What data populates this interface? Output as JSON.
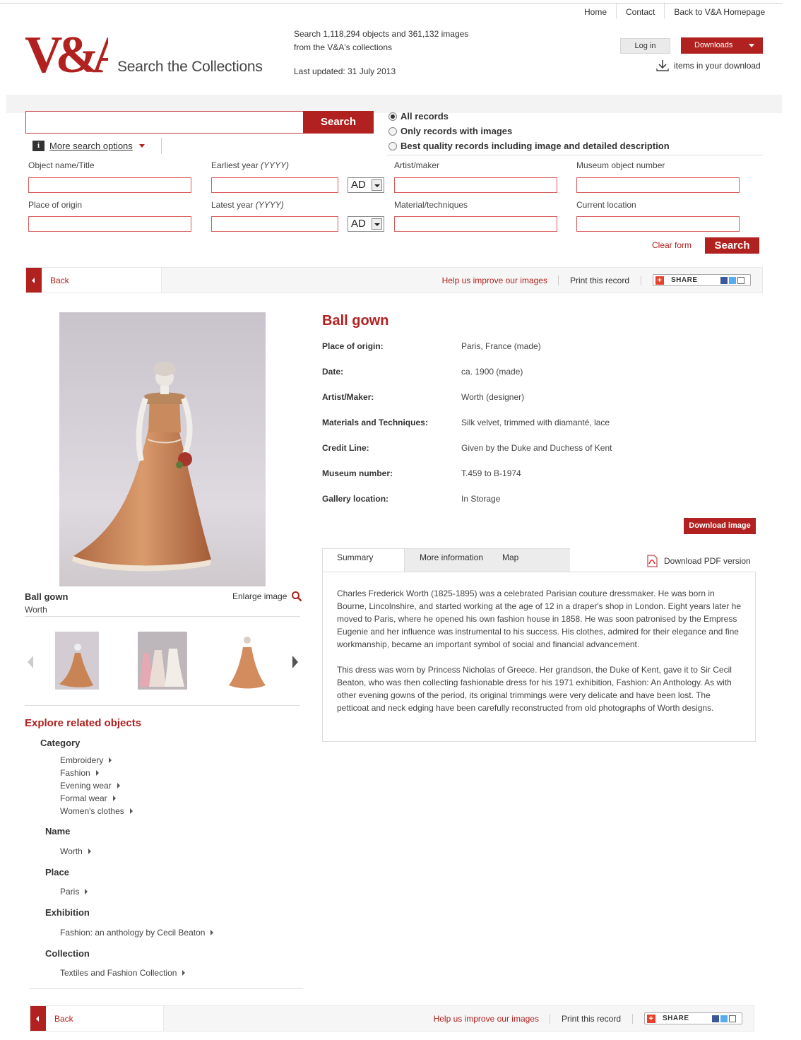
{
  "topnav": {
    "home": "Home",
    "contact": "Contact",
    "back_va": "Back to V&A Homepage"
  },
  "header": {
    "logo_text": "V&A",
    "site_title": "Search the Collections",
    "stats_line1": "Search 1,118,294 objects and 361,132 images",
    "stats_line2": "from the V&A's collections",
    "last_updated": "Last updated: 31 July 2013",
    "login": "Log in",
    "downloads": "Downloads",
    "download_items": "items in your download"
  },
  "search": {
    "button": "Search",
    "more_options": "More search options",
    "radios": [
      {
        "label": "All records",
        "checked": true
      },
      {
        "label": "Only records with images",
        "checked": false
      },
      {
        "label": "Best quality records including image and detailed description",
        "checked": false
      }
    ]
  },
  "form": {
    "object_name": "Object name/Title",
    "earliest_year": "Earliest year",
    "latest_year": "Latest year",
    "year_hint": "(YYYY)",
    "era1": "AD",
    "era2": "AD",
    "artist": "Artist/maker",
    "museum_number": "Museum object number",
    "place": "Place of origin",
    "material": "Material/techniques",
    "location": "Current location",
    "clear": "Clear form",
    "search": "Search"
  },
  "recbar": {
    "back": "Back",
    "help": "Help us improve our images",
    "print": "Print this record",
    "share": "SHARE"
  },
  "object": {
    "title": "Ball gown",
    "details": [
      {
        "key": "Place of origin:",
        "value": "Paris, France (made)"
      },
      {
        "key": "Date:",
        "value": "ca. 1900 (made)"
      },
      {
        "key": "Artist/Maker:",
        "value": "Worth (designer)"
      },
      {
        "key": "Materials and Techniques:",
        "value": "Silk velvet, trimmed with diamanté, lace"
      },
      {
        "key": "Credit Line:",
        "value": "Given by the Duke and Duchess of Kent"
      },
      {
        "key": "Museum number:",
        "value": "T.459 to B-1974"
      },
      {
        "key": "Gallery location:",
        "value": "In Storage"
      }
    ],
    "download_image": "Download image",
    "caption_title": "Ball gown",
    "caption_maker": "Worth",
    "enlarge": "Enlarge image"
  },
  "tabs": {
    "summary": "Summary",
    "more": "More information",
    "map": "Map",
    "pdf": "Download PDF version",
    "summary_p1": "Charles Frederick Worth (1825-1895) was a celebrated Parisian couture dressmaker. He was born in Bourne, Lincolnshire, and started working at the age of 12 in a draper's shop in London. Eight years later he moved to Paris, where he opened his own fashion house in 1858. He was soon patronised by the Empress Eugenie and her influence was instrumental to his success. His clothes, admired for their elegance and fine workmanship, became an important symbol of social and financial advancement.",
    "summary_p2": "This dress was worn by Princess Nicholas of Greece. Her grandson, the Duke of Kent, gave it to Sir Cecil Beaton, who was then collecting fashionable dress for his 1971 exhibition, Fashion: An Anthology. As with other evening gowns of the period, its original trimmings were very delicate and have been lost. The petticoat and neck edging have been carefully reconstructed from old photographs of Worth designs."
  },
  "related": {
    "title": "Explore related objects",
    "category": "Category",
    "category_items": [
      "Embroidery",
      "Fashion",
      "Evening wear",
      "Formal wear",
      "Women's clothes"
    ],
    "name": "Name",
    "name_items": [
      "Worth"
    ],
    "place": "Place",
    "place_items": [
      "Paris"
    ],
    "exhibition": "Exhibition",
    "exhibition_items": [
      "Fashion: an anthology by Cecil Beaton"
    ],
    "collection": "Collection",
    "collection_items": [
      "Textiles and Fashion Collection"
    ]
  },
  "colors": {
    "accent": "#b1211f"
  }
}
